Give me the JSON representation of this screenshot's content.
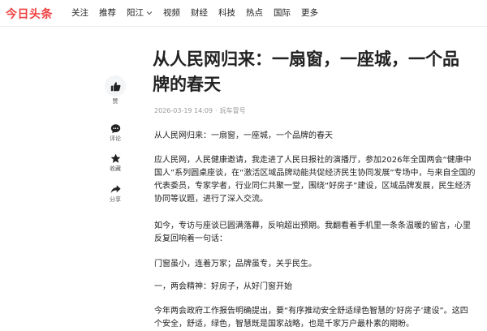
{
  "header": {
    "logo": "今日头条",
    "nav": [
      "关注",
      "推荐",
      "阳江",
      "视频",
      "财经",
      "科技",
      "热点",
      "国际",
      "更多"
    ]
  },
  "article": {
    "title": "从人民网归来：一扇窗，一座城，一个品牌的春天",
    "date": "2026-03-19 14:09",
    "author": "玩车冒号",
    "paragraphs": [
      "从人民网归来：一扇窗，一座城，一个品牌的春天",
      "应人民网，人民健康邀请，我走进了人民日报社的演播厅，参加2026年全国两会“健康中国人”系列圆桌座谈，在“激活区域品牌动能共促经济民生协同发展”专场中，与来自全国的代表委员，专家学者，行业同仁共聚一堂，围绕“好房子”建设，区域品牌发展，民生经济协同等议题，进行了深入交流。",
      "如今，专访与座谈已圆满落幕，反响超出预期。我翻看着手机里一条条温暖的留言，心里反复回响着一句话：",
      "门窗虽小，连着万家；品牌虽专，关乎民生。",
      "一，两会精神：好房子，从好门窗开始",
      "今年两会政府工作报告明确提出，要“有序推动安全舒适绿色智慧的‘好房子’建设”。这四个安全，舒适，绿色，智慧既是国家战略，也是千家万户最朴素的期盼。"
    ]
  },
  "actions": {
    "like": "赞",
    "comment": "评论",
    "collect": "收藏",
    "share": "分享"
  },
  "colors": {
    "brand": "#f04142",
    "text": "#222222",
    "meta": "#999999"
  }
}
